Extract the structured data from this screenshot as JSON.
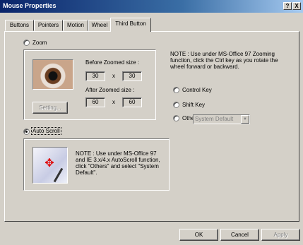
{
  "window": {
    "title": "Mouse Properties",
    "help_label": "?",
    "close_label": "X"
  },
  "tabs": [
    "Buttons",
    "Pointers",
    "Motion",
    "Wheel",
    "Third Button"
  ],
  "zoom": {
    "label": "Zoom",
    "before_label": "Before Zoomed size :",
    "before_w": "30",
    "before_h": "30",
    "after_label": "After Zoomed size :",
    "after_w": "60",
    "after_h": "60",
    "times": "x",
    "setting_label": "Setting..."
  },
  "ctrl_note": "NOTE : Use under MS-Office 97 Zooming function, click the Ctrl key as you rotate the wheel forward or backward.",
  "key_options": [
    "Control Key",
    "Shift Key",
    "Others"
  ],
  "others_select": {
    "value": "System Default",
    "arrow": "▼"
  },
  "auto_scroll": {
    "label": "Auto Scroll",
    "note": "NOTE : Use under MS-Office 97 and IE 3.x/4.x AutoScroll function, click \"Others\" and select \"System Default\"."
  },
  "icons": {
    "zoom_image": "eye-image",
    "autoscroll_image": "autoscroll-cursor-image"
  },
  "footer": {
    "ok": "OK",
    "cancel": "Cancel",
    "apply": "Apply"
  }
}
